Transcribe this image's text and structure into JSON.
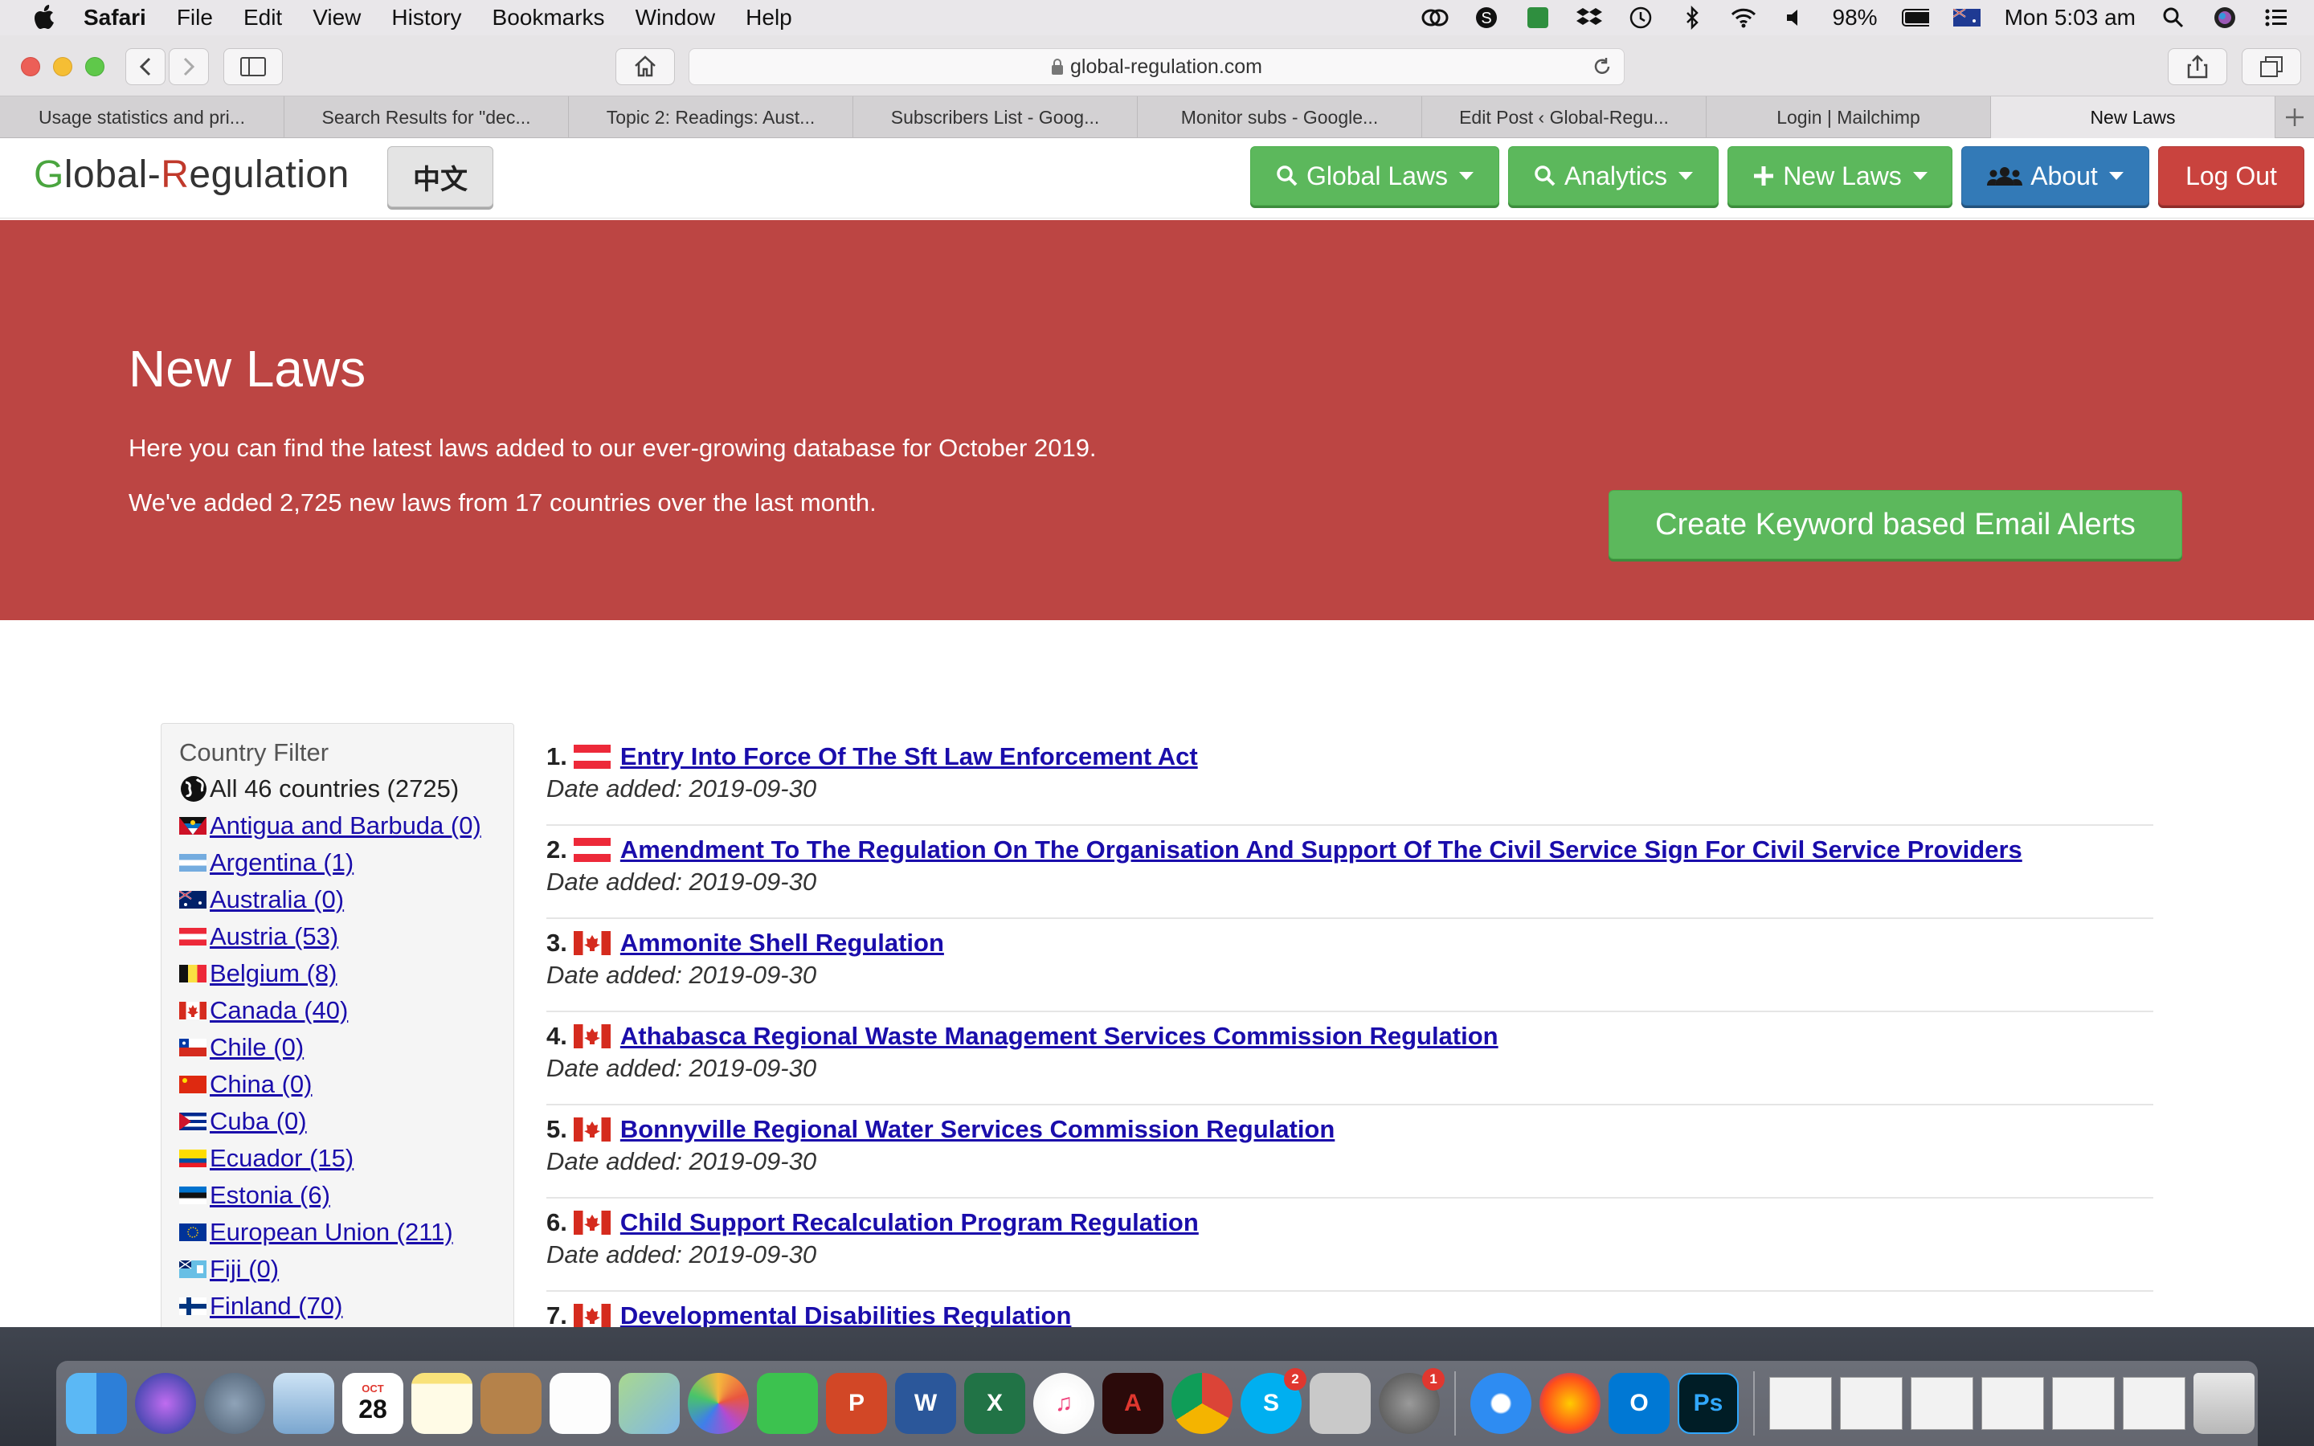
{
  "menubar": {
    "app": "Safari",
    "items": [
      "File",
      "Edit",
      "View",
      "History",
      "Bookmarks",
      "Window",
      "Help"
    ],
    "battery": "98%",
    "clock": "Mon 5:03 am"
  },
  "browser": {
    "url": "global-regulation.com",
    "tabs": [
      "Usage statistics and pri...",
      "Search Results for \"dec...",
      "Topic 2: Readings: Aust...",
      "Subscribers List - Goog...",
      "Monitor subs - Google...",
      "Edit Post ‹ Global-Regu...",
      "Login | Mailchimp",
      "New Laws"
    ]
  },
  "site": {
    "logo": {
      "g": "G",
      "lobal": "lobal-",
      "r": "R",
      "egulation": "egulation"
    },
    "lang_button": "中文",
    "nav": {
      "global_laws": "Global Laws",
      "analytics": "Analytics",
      "new_laws": "New Laws",
      "about": "About",
      "logout": "Log Out"
    },
    "hero": {
      "title": "New Laws",
      "line1": "Here you can find the latest laws added to our ever-growing database for October 2019.",
      "line2": "We've added 2,725 new laws from 17 countries over the last month.",
      "alert_button": "Create Keyword based Email Alerts"
    },
    "filter": {
      "title": "Country Filter",
      "all": "All 46 countries (2725)",
      "countries": [
        "Antigua and Barbuda (0)",
        "Argentina (1)",
        "Australia (0)",
        "Austria (53)",
        "Belgium (8)",
        "Canada (40)",
        "Chile (0)",
        "China (0)",
        "Cuba (0)",
        "Ecuador (15)",
        "Estonia (6)",
        "European Union (211)",
        "Fiji (0)",
        "Finland (70)"
      ]
    },
    "laws": [
      {
        "num": "1.",
        "title": "Entry Into Force Of The Sft Law Enforcement Act",
        "date": "Date added: 2019-09-30"
      },
      {
        "num": "2.",
        "title": "Amendment To The Regulation On The Organisation And Support Of The Civil Service Sign For Civil Service Providers",
        "date": "Date added: 2019-09-30"
      },
      {
        "num": "3.",
        "title": "Ammonite Shell Regulation",
        "date": "Date added: 2019-09-30"
      },
      {
        "num": "4.",
        "title": "Athabasca Regional Waste Management Services Commission Regulation",
        "date": "Date added: 2019-09-30"
      },
      {
        "num": "5.",
        "title": "Bonnyville Regional Water Services Commission Regulation",
        "date": "Date added: 2019-09-30"
      },
      {
        "num": "6.",
        "title": "Child Support Recalculation Program Regulation",
        "date": "Date added: 2019-09-30"
      },
      {
        "num": "7.",
        "title": "Developmental Disabilities Regulation",
        "date": ""
      }
    ]
  },
  "dock": {
    "calendar_month": "OCT",
    "calendar_day": "28",
    "skype_badge": "2",
    "prefs_badge": "1"
  },
  "colors": {
    "hero_bg": "#bc4543",
    "green_btn": "#5cb85c",
    "blue_btn": "#337ab7",
    "red_btn": "#c9433e",
    "link": "#1a0dab"
  }
}
